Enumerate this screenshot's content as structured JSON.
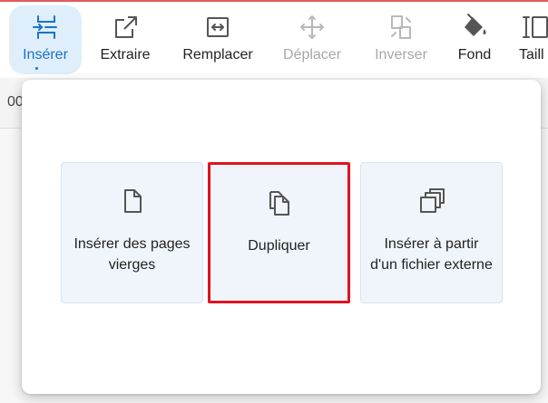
{
  "toolbar": {
    "items": [
      {
        "label": "Insérer",
        "icon": "insert-between-icon",
        "state": "active"
      },
      {
        "label": "Extraire",
        "icon": "extract-icon",
        "state": "normal"
      },
      {
        "label": "Remplacer",
        "icon": "replace-icon",
        "state": "normal"
      },
      {
        "label": "Déplacer",
        "icon": "move-icon",
        "state": "disabled"
      },
      {
        "label": "Inverser",
        "icon": "invert-icon",
        "state": "disabled"
      },
      {
        "label": "Fond",
        "icon": "paint-bucket-icon",
        "state": "normal"
      },
      {
        "label": "Taill",
        "icon": "size-icon",
        "state": "normal"
      }
    ]
  },
  "background": {
    "page_number_fragment": "00"
  },
  "insert_menu": {
    "options": [
      {
        "label": "Insérer des pages vierges",
        "icon": "blank-page-icon"
      },
      {
        "label": "Dupliquer",
        "icon": "duplicate-icon",
        "highlighted": true
      },
      {
        "label": "Insérer à partir d'un fichier externe",
        "icon": "external-file-icon"
      }
    ]
  },
  "colors": {
    "accent": "#1a73c8",
    "active_bg": "#dfeefb",
    "card_bg": "#eff5fb",
    "highlight_border": "#e0141e",
    "disabled_text": "#a7a7a7",
    "icon": "#555555"
  }
}
